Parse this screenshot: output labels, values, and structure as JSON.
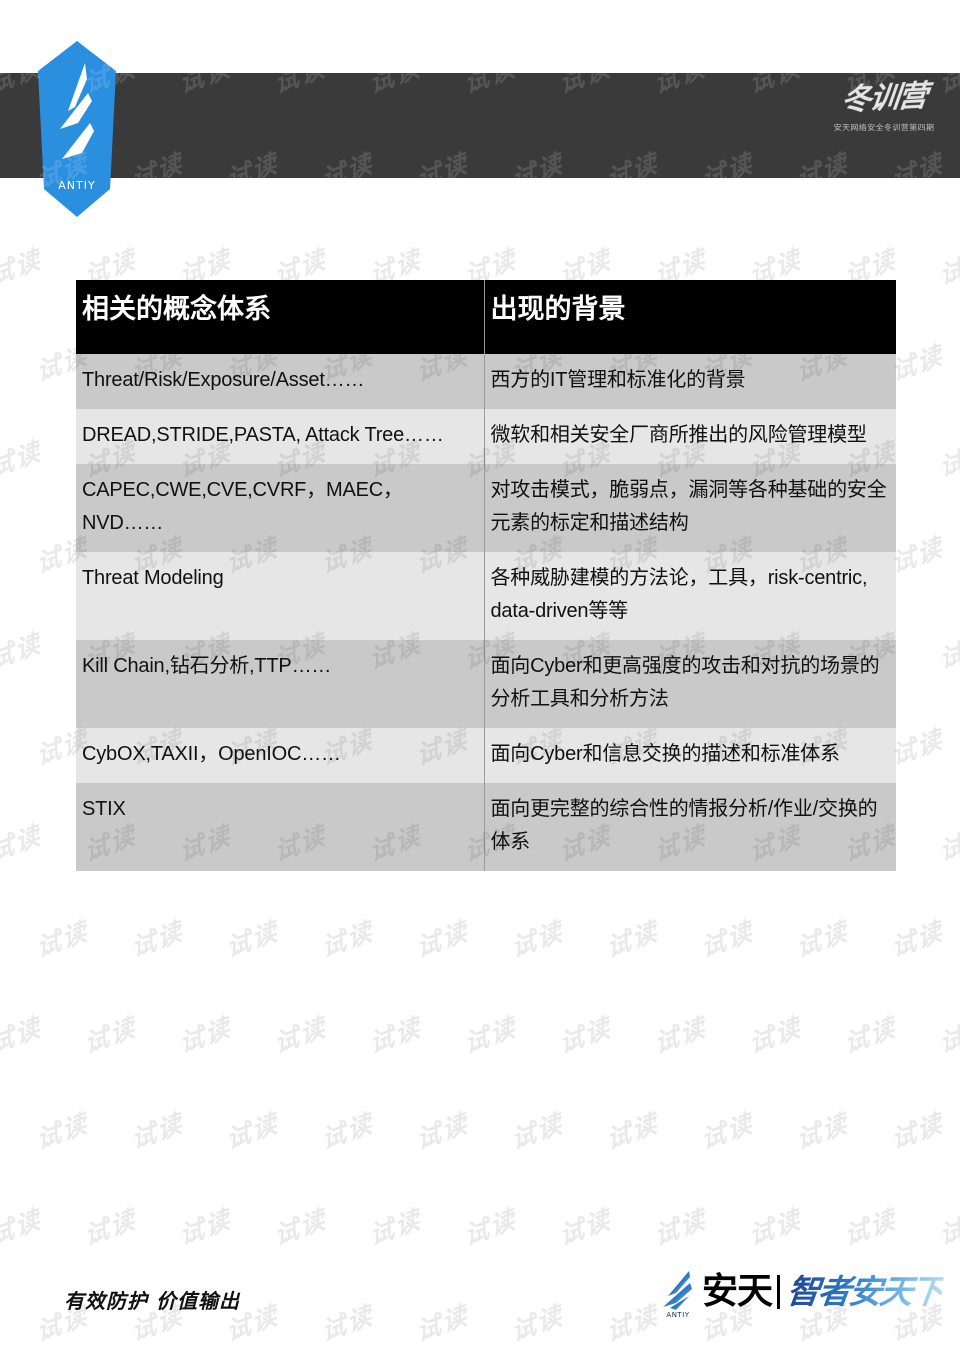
{
  "slide": {
    "brand": {
      "header_logo_name": "antiy-hexagon-logo",
      "header_logo_text": "ANTIY",
      "header_calligraphy_main": "冬训营",
      "header_calligraphy_sub": "安天网络安全冬训营第四期",
      "accent_blue": "#2b8fe0",
      "header_bar_color": "#3a3a3a"
    },
    "table": {
      "headers": [
        "相关的概念体系",
        "出现的背景"
      ],
      "rows": [
        {
          "concept": "Threat/Risk/Exposure/Asset……",
          "background": "西方的IT管理和标准化的背景"
        },
        {
          "concept": "DREAD,STRIDE,PASTA, Attack Tree……",
          "background": "微软和相关安全厂商所推出的风险管理模型"
        },
        {
          "concept": "CAPEC,CWE,CVE,CVRF，MAEC，NVD……",
          "background": "对攻击模式，脆弱点，漏洞等各种基础的安全元素的标定和描述结构"
        },
        {
          "concept": "Threat Modeling",
          "background": "各种威胁建模的方法论，工具，risk-centric, data-driven等等"
        },
        {
          "concept": "Kill Chain,钻石分析,TTP……",
          "background": "面向Cyber和更高强度的攻击和对抗的场景的分析工具和分析方法"
        },
        {
          "concept": "CybOX,TAXII，OpenIOC……",
          "background": "面向Cyber和信息交换的描述和标准体系"
        },
        {
          "concept": "STIX",
          "background": "面向更完整的综合性的情报分析/作业/交换的体系"
        }
      ]
    },
    "footer": {
      "slogan": "有效防护 价值输出",
      "logo_cn": "安天",
      "logo_mark_text": "ANTIY",
      "logo_tagline": "智者安天下"
    },
    "watermark": {
      "text": "试读"
    }
  }
}
